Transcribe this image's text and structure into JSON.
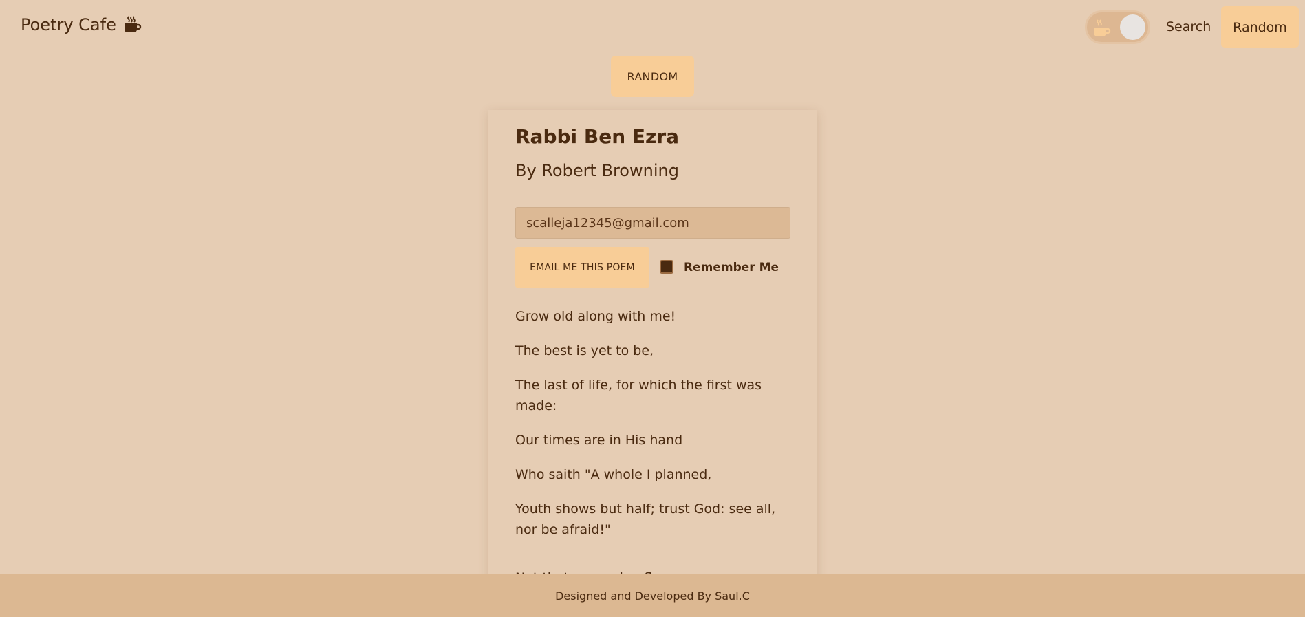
{
  "app": {
    "brand": "Poetry Cafe",
    "brand_icon": "coffee-cup-icon"
  },
  "nav": {
    "theme_toggle_icon": "coffee-cup-icon",
    "search_label": "Search",
    "random_label": "Random"
  },
  "main": {
    "random_button": "RANDOM"
  },
  "poem": {
    "title": "Rabbi Ben Ezra",
    "author": "By Robert Browning",
    "email_value": "scalleja12345@gmail.com",
    "email_button": "EMAIL ME THIS POEM",
    "remember_label": "Remember Me",
    "remember_checked": true,
    "lines": [
      "Grow old along with me!",
      "The best is yet to be,",
      "The last of life, for which the first was made:",
      "Our times are in His hand",
      "Who saith \"A whole I planned,",
      "Youth shows but half; trust God: see all, nor be afraid!\"",
      "Not that, amassing flowers,"
    ]
  },
  "footer": {
    "credit": "Designed and Developed By Saul.C"
  },
  "colors": {
    "background": "#e6cdb4",
    "accent": "#f8cd97",
    "text": "#4a2a10",
    "footer": "#dcb892"
  }
}
